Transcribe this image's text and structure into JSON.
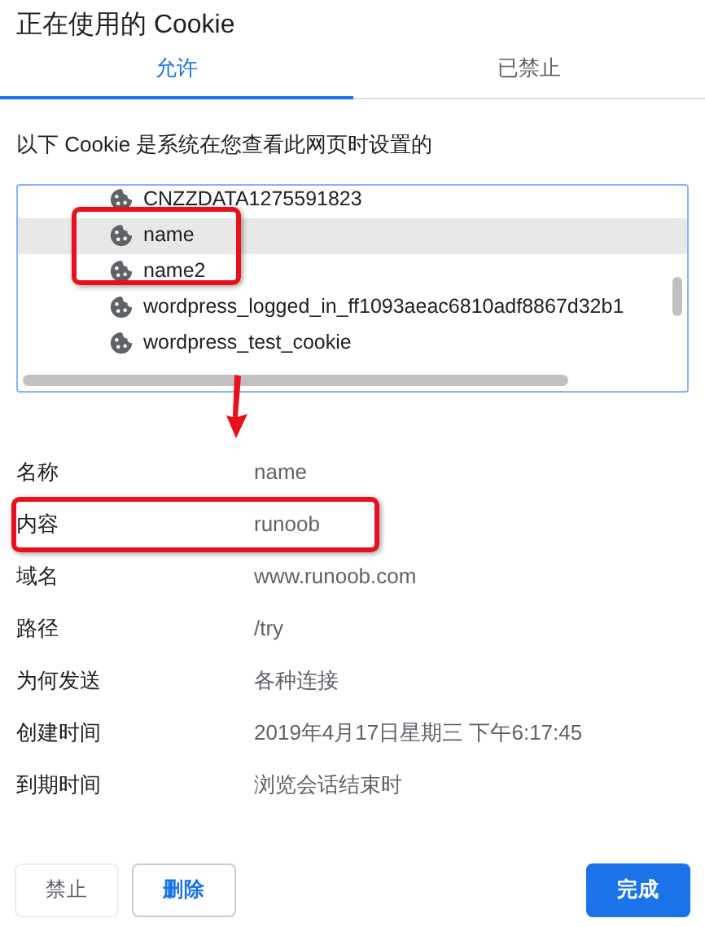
{
  "title": "正在使用的 Cookie",
  "tabs": [
    {
      "label": "允许",
      "selected": true
    },
    {
      "label": "已禁止",
      "selected": false
    }
  ],
  "description": "以下 Cookie 是系统在您查看此网页时设置的",
  "cookies": [
    {
      "name": "CNZZDATA1275591823",
      "selected": false,
      "highlighted": false
    },
    {
      "name": "name",
      "selected": true,
      "highlighted": true
    },
    {
      "name": "name2",
      "selected": false,
      "highlighted": true
    },
    {
      "name": "wordpress_logged_in_ff1093aeac6810adf8867d32b1",
      "selected": false,
      "highlighted": false
    },
    {
      "name": "wordpress_test_cookie",
      "selected": false,
      "highlighted": false
    }
  ],
  "annotation_arrow": true,
  "details": [
    {
      "label": "名称",
      "value": "name",
      "highlighted": false
    },
    {
      "label": "内容",
      "value": "runoob",
      "highlighted": true
    },
    {
      "label": "域名",
      "value": "www.runoob.com",
      "highlighted": false
    },
    {
      "label": "路径",
      "value": "/try",
      "highlighted": false
    },
    {
      "label": "为何发送",
      "value": "各种连接",
      "highlighted": false
    },
    {
      "label": "创建时间",
      "value": "2019年4月17日星期三 下午6:17:45",
      "highlighted": false
    },
    {
      "label": "到期时间",
      "value": "浏览会话结束时",
      "highlighted": false
    }
  ],
  "buttons": [
    {
      "label": "禁止",
      "kind": "plain"
    },
    {
      "label": "删除",
      "kind": "outline"
    },
    {
      "label": "完成",
      "kind": "primary"
    }
  ]
}
